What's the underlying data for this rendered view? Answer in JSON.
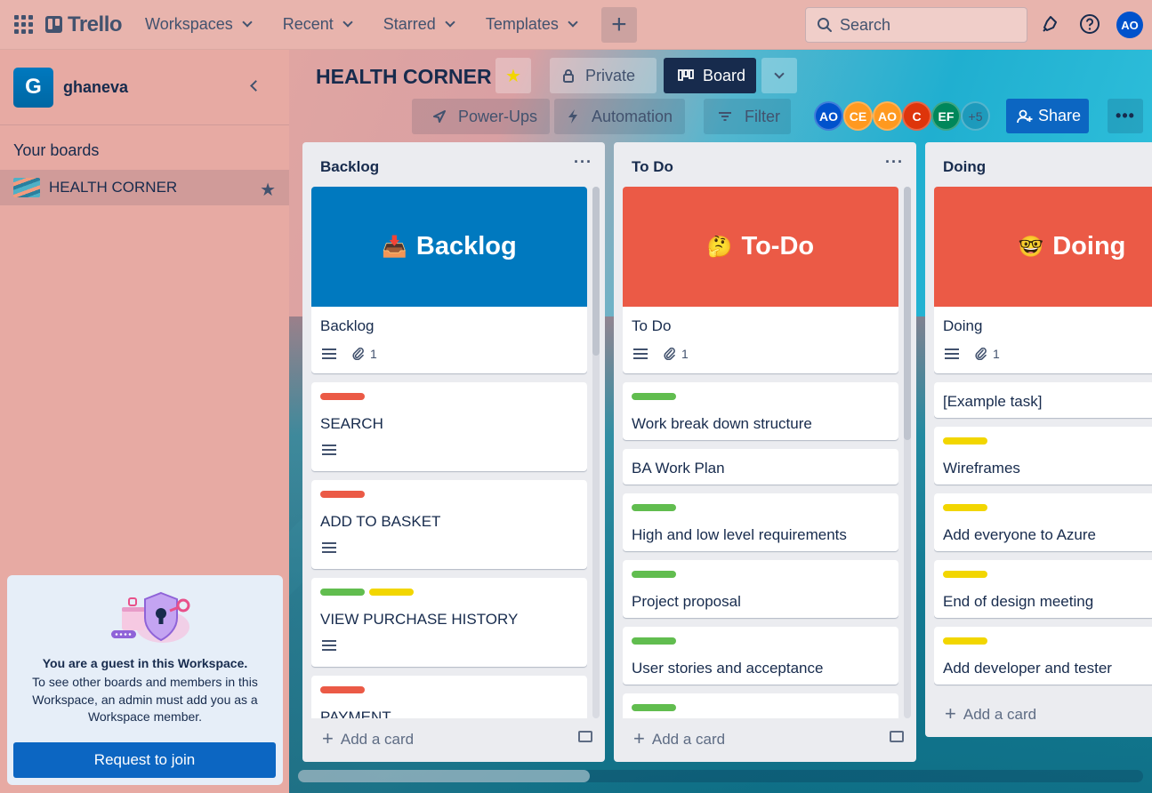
{
  "header": {
    "logo_text": "Trello",
    "nav": [
      "Workspaces",
      "Recent",
      "Starred",
      "Templates"
    ],
    "create_label": "+",
    "search_placeholder": "Search",
    "user_initials": "AO"
  },
  "sidebar": {
    "workspace_initial": "G",
    "workspace_name": "ghaneva",
    "your_boards_label": "Your boards",
    "boards": [
      {
        "name": "HEALTH CORNER"
      }
    ],
    "guest": {
      "title": "You are a guest in this Workspace.",
      "text": "To see other boards and members in this Workspace, an admin must add you as a Workspace member.",
      "button": "Request to join"
    }
  },
  "board": {
    "title": "HEALTH CORNER",
    "visibility": "Private",
    "view": "Board",
    "toolbar": {
      "power_ups": "Power-Ups",
      "automation": "Automation",
      "filter": "Filter"
    },
    "members": [
      {
        "initials": "AO",
        "color": "#0052cc"
      },
      {
        "initials": "CE",
        "color": "#ff991f"
      },
      {
        "initials": "AO",
        "color": "#ff991f"
      },
      {
        "initials": "C",
        "color": "#de350b"
      },
      {
        "initials": "EF",
        "color": "#00875a"
      }
    ],
    "extra_members": "+5",
    "share": "Share",
    "add_card": "Add a card"
  },
  "lists": [
    {
      "title": "Backlog",
      "cover": {
        "emoji": "📥",
        "text": "Backlog",
        "color": "#0079bf"
      },
      "cover_card": {
        "title": "Backlog",
        "attachments": "1"
      },
      "cards": [
        {
          "title": "SEARCH",
          "labels": [
            "#eb5a46"
          ]
        },
        {
          "title": "ADD TO BASKET",
          "labels": [
            "#eb5a46"
          ]
        },
        {
          "title": "VIEW PURCHASE HISTORY",
          "labels": [
            "#61bd4f",
            "#f2d600"
          ]
        },
        {
          "title": "PAYMENT",
          "labels": [
            "#eb5a46"
          ]
        }
      ]
    },
    {
      "title": "To Do",
      "cover": {
        "emoji": "🤔",
        "text": "To-Do",
        "color": "#eb5a46"
      },
      "cover_card": {
        "title": "To Do",
        "attachments": "1"
      },
      "cards": [
        {
          "title": "Work break down structure",
          "labels": [
            "#61bd4f"
          ]
        },
        {
          "title": "BA Work Plan",
          "labels": []
        },
        {
          "title": "High and low level requirements",
          "labels": [
            "#61bd4f"
          ]
        },
        {
          "title": "Project proposal",
          "labels": [
            "#61bd4f"
          ]
        },
        {
          "title": "User stories and acceptance",
          "labels": [
            "#61bd4f"
          ]
        }
      ]
    },
    {
      "title": "Doing",
      "cover": {
        "emoji": "🤓",
        "text": "Doing",
        "color": "#eb5a46"
      },
      "cover_card": {
        "title": "Doing",
        "attachments": "1"
      },
      "cards": [
        {
          "title": "[Example task]",
          "labels": []
        },
        {
          "title": "Wireframes",
          "labels": [
            "#f2d600"
          ]
        },
        {
          "title": "Add everyone to Azure",
          "labels": [
            "#f2d600"
          ]
        },
        {
          "title": "End of design meeting",
          "labels": [
            "#f2d600"
          ]
        },
        {
          "title": "Add developer and tester",
          "labels": [
            "#f2d600"
          ]
        }
      ]
    }
  ]
}
